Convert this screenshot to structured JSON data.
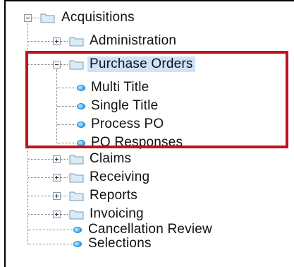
{
  "tree": {
    "root": {
      "label": "Acquisitions",
      "expanded": true
    },
    "children": [
      {
        "key": "administration",
        "label": "Administration",
        "type": "folder",
        "expanded": false
      },
      {
        "key": "purchase_orders",
        "label": "Purchase Orders",
        "type": "folder",
        "expanded": true,
        "selected": true,
        "children": [
          {
            "key": "multi_title",
            "label": "Multi Title",
            "type": "leaf"
          },
          {
            "key": "single_title",
            "label": "Single Title",
            "type": "leaf"
          },
          {
            "key": "process_po",
            "label": "Process PO",
            "type": "leaf"
          },
          {
            "key": "po_responses",
            "label": "PO Responses",
            "type": "leaf"
          }
        ]
      },
      {
        "key": "claims",
        "label": "Claims",
        "type": "folder",
        "expanded": false
      },
      {
        "key": "receiving",
        "label": "Receiving",
        "type": "folder",
        "expanded": false
      },
      {
        "key": "reports",
        "label": "Reports",
        "type": "folder",
        "expanded": false
      },
      {
        "key": "invoicing",
        "label": "Invoicing",
        "type": "folder",
        "expanded": false
      },
      {
        "key": "cancellation_review",
        "label": "Cancellation Review",
        "type": "leaf"
      },
      {
        "key": "selections",
        "label": "Selections",
        "type": "leaf"
      }
    ]
  },
  "colors": {
    "highlight_border": "#c3111b",
    "selection_bg": "#cfe2f7",
    "folder_fill": "#d9ecf7",
    "leaf_bullet": "#55b6f2"
  }
}
